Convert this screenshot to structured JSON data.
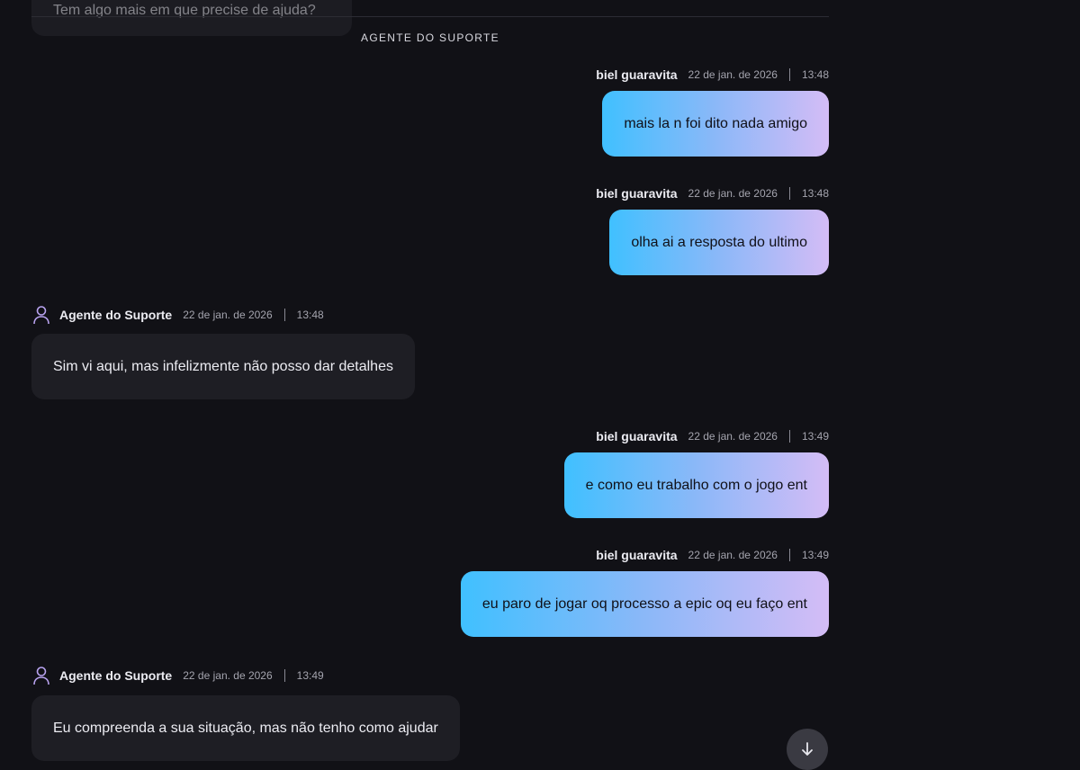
{
  "system": {
    "previous_message": "Tem algo mais em que precise de ajuda?",
    "divider_label": "AGENTE DO SUPORTE"
  },
  "messages": [
    {
      "role": "user",
      "sender": "biel guaravita",
      "date": "22 de jan. de 2026",
      "time": "13:48",
      "text": "mais la n foi dito nada amigo"
    },
    {
      "role": "user",
      "sender": "biel guaravita",
      "date": "22 de jan. de 2026",
      "time": "13:48",
      "text": "olha ai a resposta do ultimo"
    },
    {
      "role": "agent",
      "sender": "Agente do Suporte",
      "date": "22 de jan. de 2026",
      "time": "13:48",
      "text": "Sim vi aqui, mas infelizmente não posso dar detalhes",
      "icon": "person-icon"
    },
    {
      "role": "user",
      "sender": "biel guaravita",
      "date": "22 de jan. de 2026",
      "time": "13:49",
      "text": "e como eu trabalho com o jogo ent"
    },
    {
      "role": "user",
      "sender": "biel guaravita",
      "date": "22 de jan. de 2026",
      "time": "13:49",
      "text": "eu paro de jogar oq processo a epic oq eu faço ent"
    },
    {
      "role": "agent",
      "sender": "Agente do Suporte",
      "date": "22 de jan. de 2026",
      "time": "13:49",
      "text": "Eu compreenda a sua situação, mas não tenho como ajudar",
      "icon": "person-icon"
    }
  ],
  "scroll_button": {
    "icon": "arrow-down-icon"
  },
  "colors": {
    "background": "#111116",
    "agent_bubble": "#1e1e24",
    "user_gradient_start": "#40c0ff",
    "user_gradient_end": "#d4bcf6",
    "agent_icon": "#b9a3f0"
  }
}
